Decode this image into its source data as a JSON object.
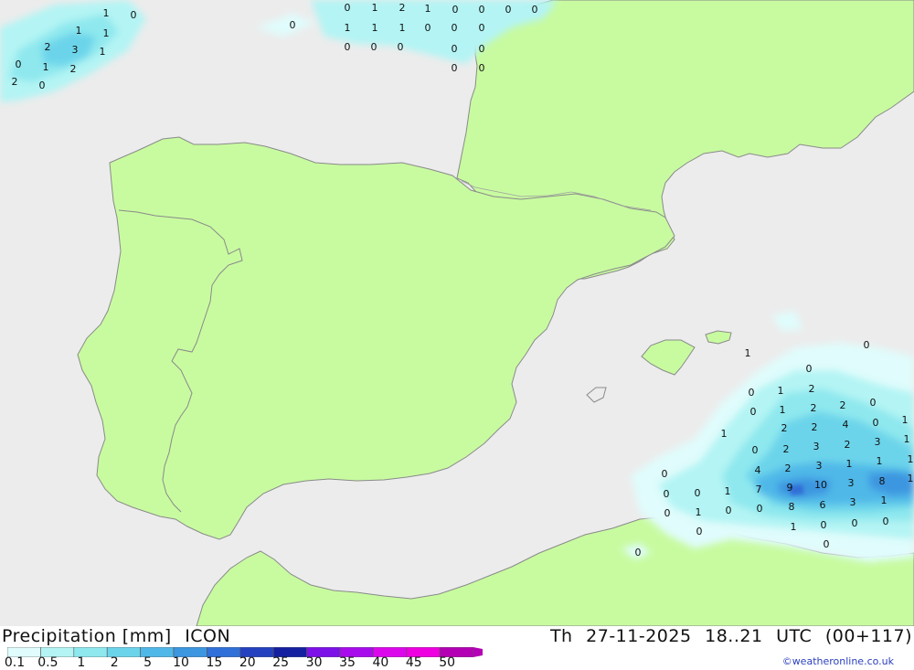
{
  "title": {
    "label": "Precipitation [mm]",
    "model": "ICON",
    "day": "Th",
    "date": "27-11-2025",
    "hours": "18..21",
    "tz": "UTC",
    "run": "(00+117)"
  },
  "legend": {
    "values": [
      "0.1",
      "0.5",
      "1",
      "2",
      "5",
      "10",
      "15",
      "20",
      "25",
      "30",
      "35",
      "40",
      "45",
      "50"
    ],
    "colors": [
      "#e0fcfc",
      "#b4f4f4",
      "#8ee8ee",
      "#6cd4ea",
      "#50b8e8",
      "#3c96e0",
      "#3070d8",
      "#2442c0",
      "#1420a0",
      "#7c12e8",
      "#a80cec",
      "#dc08ec",
      "#ee00e0",
      "#b400b4"
    ]
  },
  "credit": "©weatheronline.co.uk",
  "colors": {
    "sea": "#ececec",
    "land": "#c8fba0",
    "border": "#8a8a8a"
  },
  "map_values": [
    {
      "v": "1"
    },
    {
      "v": "0"
    },
    {
      "v": "1"
    },
    {
      "v": "1"
    },
    {
      "v": "2"
    },
    {
      "v": "3"
    },
    {
      "v": "1"
    },
    {
      "v": "0"
    },
    {
      "v": "1"
    },
    {
      "v": "2"
    },
    {
      "v": "2"
    },
    {
      "v": "0"
    },
    {
      "v": "0"
    },
    {
      "v": "0"
    },
    {
      "v": "1"
    },
    {
      "v": "2"
    },
    {
      "v": "1"
    },
    {
      "v": "0"
    },
    {
      "v": "0"
    },
    {
      "v": "0"
    },
    {
      "v": "0"
    },
    {
      "v": "1"
    },
    {
      "v": "1"
    },
    {
      "v": "1"
    },
    {
      "v": "0"
    },
    {
      "v": "0"
    },
    {
      "v": "0"
    },
    {
      "v": "0"
    },
    {
      "v": "0"
    },
    {
      "v": "0"
    },
    {
      "v": "0"
    },
    {
      "v": "0"
    },
    {
      "v": "0"
    },
    {
      "v": "0"
    },
    {
      "v": "1"
    },
    {
      "v": "0"
    },
    {
      "v": "0"
    },
    {
      "v": "0"
    },
    {
      "v": "1"
    },
    {
      "v": "2"
    },
    {
      "v": "0"
    },
    {
      "v": "1"
    },
    {
      "v": "2"
    },
    {
      "v": "2"
    },
    {
      "v": "0"
    },
    {
      "v": "2"
    },
    {
      "v": "2"
    },
    {
      "v": "4"
    },
    {
      "v": "0"
    },
    {
      "v": "1"
    },
    {
      "v": "0"
    },
    {
      "v": "2"
    },
    {
      "v": "3"
    },
    {
      "v": "2"
    },
    {
      "v": "3"
    },
    {
      "v": "1"
    },
    {
      "v": "4"
    },
    {
      "v": "2"
    },
    {
      "v": "3"
    },
    {
      "v": "1"
    },
    {
      "v": "1"
    },
    {
      "v": "1"
    },
    {
      "v": "0"
    },
    {
      "v": "0"
    },
    {
      "v": "0"
    },
    {
      "v": "1"
    },
    {
      "v": "7"
    },
    {
      "v": "9"
    },
    {
      "v": "10"
    },
    {
      "v": "3"
    },
    {
      "v": "8"
    },
    {
      "v": "1"
    },
    {
      "v": "0"
    },
    {
      "v": "1"
    },
    {
      "v": "0"
    },
    {
      "v": "0"
    },
    {
      "v": "8"
    },
    {
      "v": "6"
    },
    {
      "v": "3"
    },
    {
      "v": "1"
    },
    {
      "v": "0"
    },
    {
      "v": "0"
    },
    {
      "v": "1"
    },
    {
      "v": "0"
    },
    {
      "v": "0"
    },
    {
      "v": "0"
    },
    {
      "v": "0"
    },
    {
      "v": "1"
    }
  ]
}
